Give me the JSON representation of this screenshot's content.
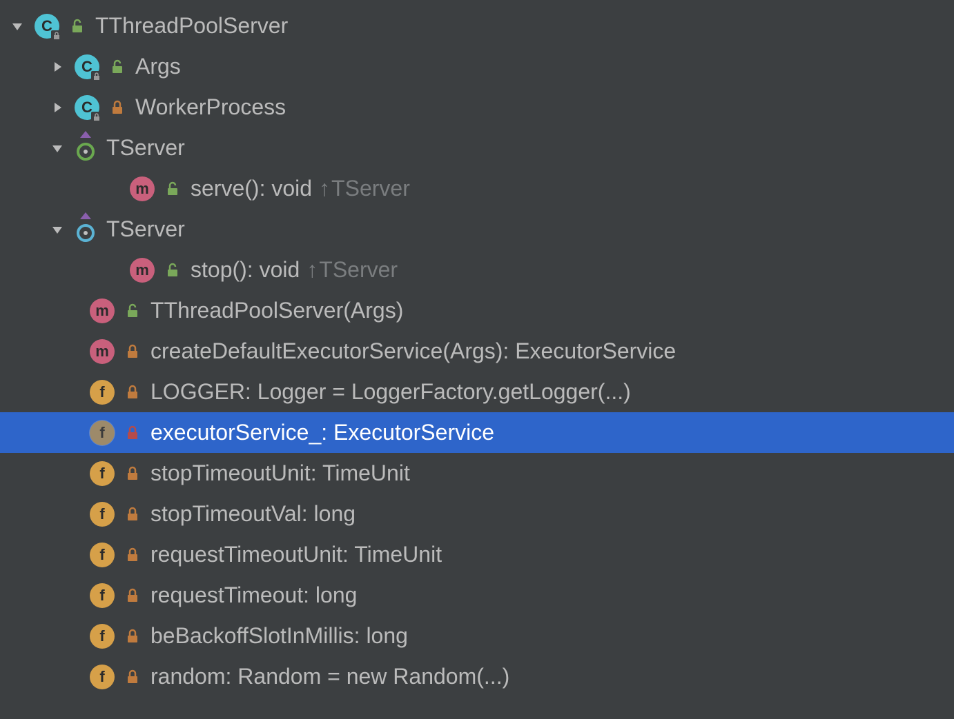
{
  "tree": {
    "root": {
      "label": "TThreadPoolServer",
      "children": {
        "args": {
          "label": "Args"
        },
        "worker": {
          "label": "WorkerProcess"
        },
        "tserver1": {
          "label": "TServer",
          "method": {
            "label": "serve(): void",
            "from": "TServer"
          }
        },
        "tserver2": {
          "label": "TServer",
          "method": {
            "label": "stop(): void",
            "from": "TServer"
          }
        },
        "ctor": {
          "label": "TThreadPoolServer(Args)"
        },
        "createExec": {
          "label": "createDefaultExecutorService(Args): ExecutorService"
        },
        "logger": {
          "label": "LOGGER: Logger = LoggerFactory.getLogger(...)"
        },
        "execService": {
          "label": "executorService_: ExecutorService"
        },
        "stopTimeoutUnit": {
          "label": "stopTimeoutUnit: TimeUnit"
        },
        "stopTimeoutVal": {
          "label": "stopTimeoutVal: long"
        },
        "requestTimeoutUnit": {
          "label": "requestTimeoutUnit: TimeUnit"
        },
        "requestTimeout": {
          "label": "requestTimeout: long"
        },
        "beBackoff": {
          "label": "beBackoffSlotInMillis: long"
        },
        "random": {
          "label": "random: Random = new Random(...)"
        }
      }
    }
  }
}
